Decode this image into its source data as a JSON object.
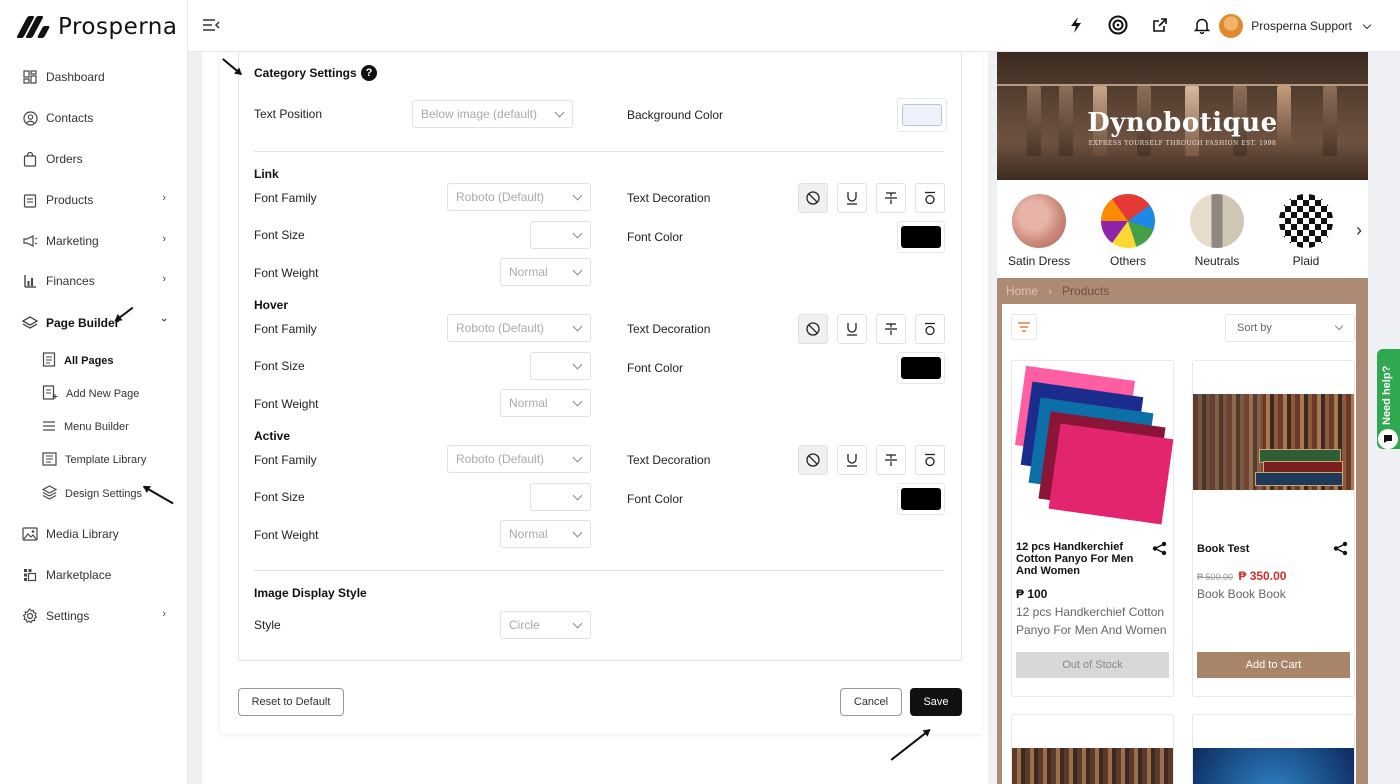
{
  "app": {
    "logo_text": "Prosperna"
  },
  "sidebar": {
    "items": [
      {
        "label": "Dashboard",
        "icon": "dashboard-icon"
      },
      {
        "label": "Contacts",
        "icon": "contacts-icon"
      },
      {
        "label": "Orders",
        "icon": "orders-icon"
      },
      {
        "label": "Products",
        "icon": "products-icon",
        "has_chevron": true
      },
      {
        "label": "Marketing",
        "icon": "megaphone-icon",
        "has_chevron": true
      },
      {
        "label": "Finances",
        "icon": "bar-chart-icon",
        "has_chevron": true
      },
      {
        "label": "Page Builder",
        "icon": "layers-icon",
        "expanded": true
      },
      {
        "label": "Media Library",
        "icon": "image-icon"
      },
      {
        "label": "Marketplace",
        "icon": "marketplace-icon"
      },
      {
        "label": "Settings",
        "icon": "gear-icon",
        "has_chevron": true
      }
    ],
    "page_builder_sub": [
      {
        "label": "All Pages",
        "icon": "page-icon"
      },
      {
        "label": "Add New Page",
        "icon": "add-page-icon"
      },
      {
        "label": "Menu Builder",
        "icon": "menu-icon"
      },
      {
        "label": "Template Library",
        "icon": "template-icon"
      },
      {
        "label": "Design Settings",
        "icon": "design-icon"
      }
    ]
  },
  "topbar": {
    "user_name": "Prosperna Support",
    "icons": [
      "lightning-icon",
      "target-icon",
      "external-link-icon",
      "bell-icon"
    ]
  },
  "category_settings": {
    "title": "Category Settings",
    "text_position_label": "Text Position",
    "text_position_value": "Below image (default)",
    "background_color_label": "Background Color",
    "background_color": "#eef3fb",
    "sections": [
      {
        "title": "Link",
        "font_family_label": "Font Family",
        "font_family": "Roboto (Default)",
        "font_size_label": "Font Size",
        "font_size": "",
        "font_weight_label": "Font Weight",
        "font_weight": "Normal",
        "text_decoration_label": "Text Decoration",
        "font_color_label": "Font Color",
        "font_color": "#000000"
      },
      {
        "title": "Hover",
        "font_family_label": "Font Family",
        "font_family": "Roboto (Default)",
        "font_size_label": "Font Size",
        "font_size": "",
        "font_weight_label": "Font Weight",
        "font_weight": "Normal",
        "text_decoration_label": "Text Decoration",
        "font_color_label": "Font Color",
        "font_color": "#000000"
      },
      {
        "title": "Active",
        "font_family_label": "Font Family",
        "font_family": "Roboto (Default)",
        "font_size_label": "Font Size",
        "font_size": "",
        "font_weight_label": "Font Weight",
        "font_weight": "Normal",
        "text_decoration_label": "Text Decoration",
        "font_color_label": "Font Color",
        "font_color": "#000000"
      }
    ],
    "image_display_title": "Image Display Style",
    "style_label": "Style",
    "style_value": "Circle"
  },
  "buttons": {
    "reset": "Reset to Default",
    "cancel": "Cancel",
    "save": "Save"
  },
  "preview": {
    "banner_title": "Dynobotique",
    "banner_subtitle": "EXPRESS YOURSELF THROUGH FASHION EST. 1998",
    "categories": [
      {
        "name": "Satin Dress"
      },
      {
        "name": "Others"
      },
      {
        "name": "Neutrals"
      },
      {
        "name": "Plaid"
      }
    ],
    "breadcrumb": {
      "home": "Home",
      "current": "Products"
    },
    "sort_label": "Sort by",
    "products": [
      {
        "name": "12 pcs Handkerchief Cotton Panyo For Men And Women",
        "price": "₱ 100",
        "old_price": "",
        "sale_price": "",
        "description": "12 pcs Handkerchief Cotton Panyo For Men And Women",
        "button": "Out of Stock"
      },
      {
        "name": "Book Test",
        "price": "",
        "old_price": "₱ 500.00",
        "sale_price": "₱ 350.00",
        "description": "Book Book Book",
        "button": "Add to Cart"
      }
    ]
  },
  "help": {
    "label": "Need help?"
  }
}
